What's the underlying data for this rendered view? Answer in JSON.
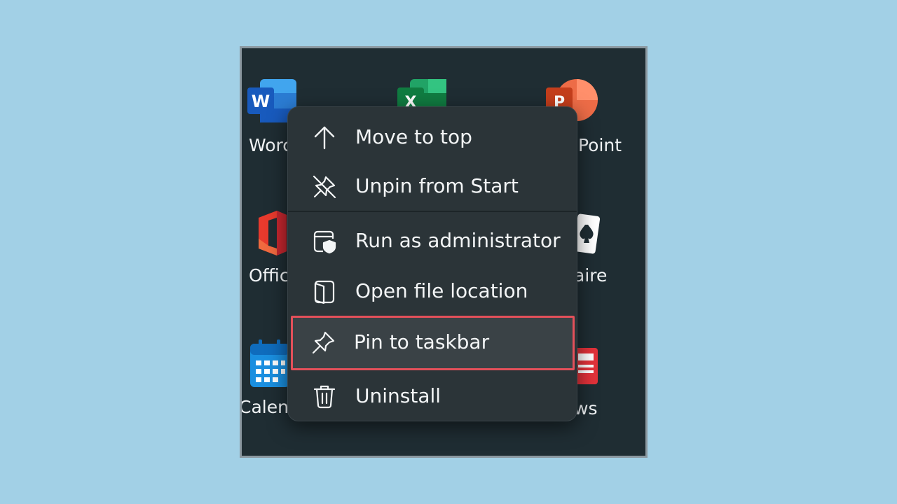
{
  "start_tiles": [
    {
      "label": "Word",
      "icon": "word-icon",
      "color": "#2b66d0"
    },
    {
      "label": "Excel",
      "icon": "excel-icon",
      "color": "#1e8a4e"
    },
    {
      "label": "PowerPoint",
      "icon": "powerpoint-icon",
      "color": "#e0562c"
    },
    {
      "label": "Office",
      "icon": "office-icon",
      "color": "#e03a2a"
    },
    {
      "label": "Solitaire",
      "icon": "solitaire-icon",
      "color": "#ffffff"
    },
    {
      "label": "Calendar",
      "icon": "calendar-icon",
      "color": "#1a8fe0"
    },
    {
      "label": "News",
      "icon": "news-icon",
      "color": "#e2323a"
    }
  ],
  "visible_tile_fragments": {
    "word": "Worc",
    "powerpoint": "Point",
    "office": "Offic",
    "solitaire": "aire",
    "calendar": "Calenc",
    "news": "ws"
  },
  "context_menu": {
    "items": [
      {
        "label": "Move to top",
        "icon": "arrow-up-icon"
      },
      {
        "label": "Unpin from Start",
        "icon": "unpin-icon"
      },
      {
        "label": "Run as administrator",
        "icon": "shield-window-icon"
      },
      {
        "label": "Open file location",
        "icon": "folder-open-icon"
      },
      {
        "label": "Pin to taskbar",
        "icon": "pin-icon",
        "highlighted": true
      },
      {
        "label": "Uninstall",
        "icon": "trash-icon"
      }
    ],
    "highlight_color": "#e3505a"
  }
}
